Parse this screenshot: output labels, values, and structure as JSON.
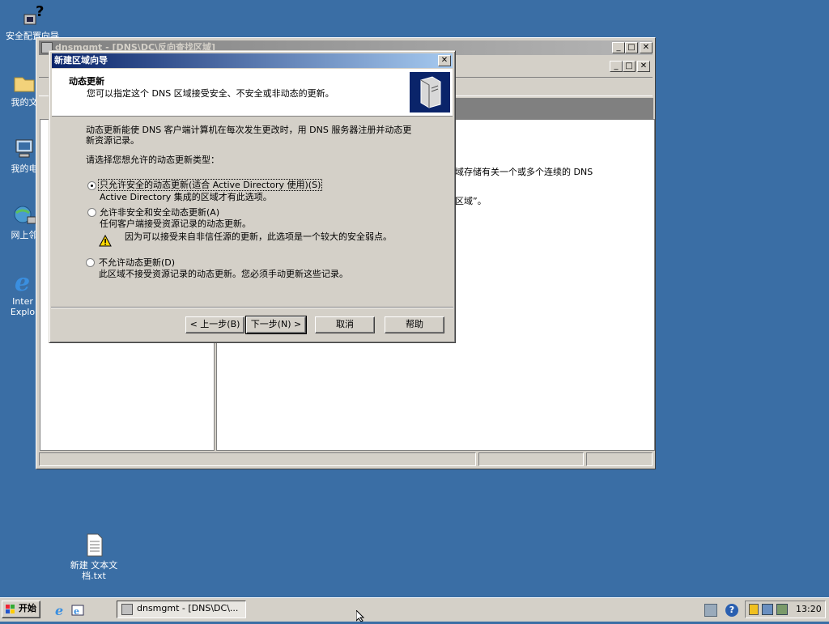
{
  "desktop": {
    "icons": [
      {
        "label": "安全配置向导"
      },
      {
        "label": "我的文"
      },
      {
        "label": "我的电"
      },
      {
        "label": "网上邻"
      },
      {
        "label": "Internet Explorer",
        "line1": "Inter",
        "line2": "Explo"
      },
      {
        "label": "新建 文本文档.txt",
        "line1": "新建 文本文",
        "line2": "档.txt"
      }
    ]
  },
  "mmc": {
    "title": "dnsmgmt - [DNS\\DC\\反向查找区域]",
    "right_text_1": "个区域存储有关一个或多个连续的 DNS",
    "right_text_2": "区域”。",
    "controls": {
      "minimize": "_",
      "maximize": "□",
      "close": "✕"
    }
  },
  "wizard": {
    "title": "新建区域向导",
    "close": "✕",
    "header_title": "动态更新",
    "header_subtitle": "您可以指定这个 DNS 区域接受安全、不安全或非动态的更新。",
    "intro_line1": "动态更新能使 DNS 客户端计算机在每次发生更改时，用 DNS 服务器注册并动态更",
    "intro_line2": "新资源记录。",
    "prompt": "请选择您想允许的动态更新类型：",
    "options": [
      {
        "label": "只允许安全的动态更新(适合 Active Directory 使用)(S)",
        "desc": "Active Directory 集成的区域才有此选项。",
        "selected": true
      },
      {
        "label": "允许非安全和安全动态更新(A)",
        "desc": "任何客户端接受资源记录的动态更新。",
        "warning": "因为可以接受来自非信任源的更新，此选项是一个较大的安全弱点。",
        "selected": false
      },
      {
        "label": "不允许动态更新(D)",
        "desc": "此区域不接受资源记录的动态更新。您必须手动更新这些记录。",
        "selected": false
      }
    ],
    "buttons": {
      "back": "< 上一步(B)",
      "next": "下一步(N) >",
      "cancel": "取消",
      "help": "帮助"
    }
  },
  "taskbar": {
    "start": "开始",
    "task": "dnsmgmt - [DNS\\DC\\...",
    "clock": "13:20"
  }
}
